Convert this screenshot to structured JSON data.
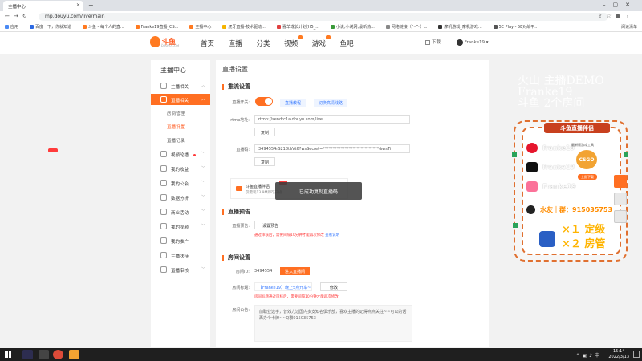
{
  "browser": {
    "tab_title": "主播中心",
    "url": "mp.douyu.com/live/main",
    "bookmarks": [
      {
        "label": "应用",
        "color": "#4a8af4"
      },
      {
        "label": "百度一下，你就知道",
        "color": "#2d6ae3"
      },
      {
        "label": "斗鱼 - 每个人的直...",
        "color": "#ff7a21"
      },
      {
        "label": "Franke19直播_CS...",
        "color": "#ff7a21"
      },
      {
        "label": "主播中心",
        "color": "#ff7a21"
      },
      {
        "label": "虎牙直播-技术驱动...",
        "color": "#f5b400"
      },
      {
        "label": "喜羊成长计划(H5_...",
        "color": "#e04040"
      },
      {
        "label": "小说,小说网,最新热...",
        "color": "#3a9a3a"
      },
      {
        "label": "网络链接（“··”·）...",
        "color": "#888888"
      },
      {
        "label": "摩机游戏_摩机游戏...",
        "color": "#333333"
      },
      {
        "label": "5E Play - 5E对战平...",
        "color": "#555555"
      }
    ],
    "reading_list": "阅读清单"
  },
  "header": {
    "logo_text": "斗鱼",
    "logo_sub": "DOUYU.COM",
    "nav": [
      "首页",
      "直播",
      "分类",
      "视频",
      "游戏",
      "鱼吧"
    ],
    "download": "下载",
    "username": "Franke19"
  },
  "sidebar": {
    "title": "主播中心",
    "items": [
      {
        "label": "主播相关"
      },
      {
        "label": "直播相关"
      },
      {
        "label": "视频轮播"
      },
      {
        "label": "我的收益"
      },
      {
        "label": "我的公会"
      },
      {
        "label": "数据分析"
      },
      {
        "label": "商业活动"
      },
      {
        "label": "我的视频"
      },
      {
        "label": "我的推广"
      },
      {
        "label": "主播扶持"
      },
      {
        "label": "直播审核"
      }
    ],
    "sub_items": [
      "房间管理",
      "直播设置",
      "直播记录"
    ]
  },
  "main": {
    "page_title": "直播设置",
    "stream_section": "推流设置",
    "switch_label": "直播开关:",
    "tutorial_link": "直播教程",
    "hd_link": "切换高清线路",
    "rtmp_label": "rtmp地址:",
    "rtmp_value": "rtmp://sendtc1a.douyu.com/live",
    "copy_label": "复制",
    "code_label": "直播码:",
    "code_value": "3494554rS218tbVt6?wsSecret=****************************&wsTi",
    "copy_label2": "复制",
    "helper_title": "斗鱼直播伴侣",
    "helper_desc": "仅需装13.9M即可开播",
    "preview_section": "直播预告",
    "preview_label": "直播预告:",
    "preview_btn": "设置预告",
    "preview_warn": "通过审核后，需要间隔10分钟才能再次修改",
    "preview_link": "查看说明",
    "room_section": "房间设置",
    "room_id_label": "房间ID:",
    "room_id": "3494554",
    "room_btn": "进入直播间",
    "room_name_label": "房间标题:",
    "room_name": "【Franke19】晚上5点开车~",
    "modify_btn": "修改",
    "room_warn": "房间标题通过审核后，需要间隔10分钟才能再次修改",
    "notice_label": "房间公告:",
    "notice_text": "前职业选手，曾效力过国内多支知名俱乐部，喜欢主播的记得点点关注~~可以的话再办个卡牌~~Q群915035753"
  },
  "toast": "已成功复制直播码",
  "overlay": {
    "title_lines": [
      "火山 主播DEMO",
      "Franke19",
      "斗鱼 2个房间"
    ],
    "promo_head": "斗鱼直播伴侣",
    "rows": [
      "franke19",
      "franke19",
      "Franke19"
    ],
    "qq": "水友｜群：915035753",
    "big1": "×１ 定级",
    "big2": "×２ 房管",
    "ad_small": "最新版游戏工具",
    "ad_logo": "CSGO",
    "ad_btn": "立即下载"
  },
  "taskbar": {
    "time": "15:14",
    "date": "2022/3/13"
  }
}
